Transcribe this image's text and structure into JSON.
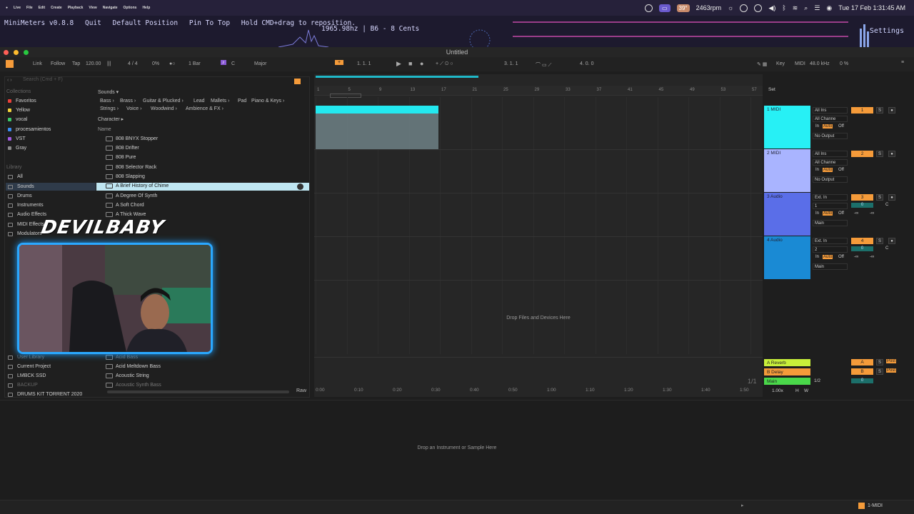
{
  "menubar": {
    "items": [
      "Live",
      "File",
      "Edit",
      "Create",
      "Playback",
      "View",
      "Navigate",
      "Options",
      "Help"
    ],
    "temp": "39°",
    "rpm": "2463rpm",
    "datetime": "Tue 17 Feb  1:31:45 AM"
  },
  "minimeters": {
    "title": "MiniMeters v0.8.8",
    "quit": "Quit",
    "default_position": "Default Position",
    "pin_to_top": "Pin To Top",
    "hint": "Hold CMD+drag to reposition.",
    "freq": "1965.98hz | B6 - 8 Cents",
    "settings": "Settings"
  },
  "window": {
    "title": "Untitled"
  },
  "control_bar": {
    "link": "Link",
    "follow": "Follow",
    "tap": "Tap",
    "tempo": "120.00",
    "signature": "4 / 4",
    "cpu": "0%",
    "quantize": "1 Bar",
    "key": "C",
    "scale": "Major",
    "position": "1.   1.   1",
    "loop_start": "3.   1.   1",
    "loop_len": "4.   0.   0",
    "key_btn": "Key",
    "midi_btn": "MIDI",
    "sample_rate": "48.0 kHz",
    "load": "0 %"
  },
  "browser": {
    "search_placeholder": "Search (Cmd + F)",
    "collections_label": "Collections",
    "collections": [
      {
        "label": "Favoritos",
        "color": "#e8413a"
      },
      {
        "label": "Yellow",
        "color": "#f0d23a"
      },
      {
        "label": "vocal",
        "color": "#3ac86a"
      },
      {
        "label": "procesamientos",
        "color": "#3a8cf0"
      },
      {
        "label": "VST",
        "color": "#a05ae0"
      },
      {
        "label": "Gray",
        "color": "#8a8a8a"
      }
    ],
    "library_label": "Library",
    "library": [
      "All",
      "Sounds",
      "Drums",
      "Instruments",
      "Audio Effects",
      "MIDI Effects",
      "Modulators"
    ],
    "places": [
      "User Library",
      "Current Project",
      "LMBCK SSD",
      "BACKUP",
      "DRUMS KIT TORRENT 2020"
    ],
    "sounds_filter": "Sounds ▾",
    "filter_row1": [
      "Bass ›",
      "Brass ›",
      "Guitar & Plucked ›",
      "Lead",
      "Mallets ›",
      "Pad",
      "Piano & Keys ›"
    ],
    "filter_row2": [
      "Strings ›",
      "Voice ›",
      "Woodwind ›",
      "Ambience & FX ›"
    ],
    "character": "Character ▸",
    "name_header": "Name",
    "files": [
      "808 BNYX Stopper",
      "808 Drifter",
      "808 Pure",
      "808 Selector Rack",
      "808 Slapping",
      "A Brief History of Chime",
      "A Degree Of Synth",
      "A Soft Chord",
      "A Thick Wave"
    ],
    "files_bottom": [
      "Acid Bass",
      "Acid Meltdown Bass",
      "Acoustic String",
      "Acoustic Synth Bass"
    ],
    "raw": "Raw"
  },
  "overlay": {
    "streamer_name": "DEVILBABY"
  },
  "arrangement": {
    "bar_ticks": [
      "1",
      "5",
      "9",
      "13",
      "17",
      "21",
      "25",
      "29",
      "33",
      "37",
      "41",
      "45",
      "49",
      "53",
      "57"
    ],
    "time_ticks": [
      "0:00",
      "0:10",
      "0:20",
      "0:30",
      "0:40",
      "0:50",
      "1:00",
      "1:10",
      "1:20",
      "1:30",
      "1:40",
      "1:50"
    ],
    "drop_files": "Drop Files and Devices Here",
    "page": "1/1",
    "set": "Set"
  },
  "tracks": [
    {
      "name": "1 MIDI",
      "color": "#27f0f5",
      "input": "All Ins",
      "channel": "All Channe",
      "output": "No Output",
      "num": "1"
    },
    {
      "name": "2 MIDI",
      "color": "#a9b4ff",
      "input": "All Ins",
      "channel": "All Channe",
      "output": "No Output",
      "num": "2"
    },
    {
      "name": "3 Audio",
      "color": "#5a6ee8",
      "input": "Ext. In",
      "channel": "1",
      "output": "Main",
      "num": "3"
    },
    {
      "name": "4 Audio",
      "color": "#1a8ad4",
      "input": "Ext. In",
      "channel": "2",
      "output": "Main",
      "num": "4"
    }
  ],
  "returns": [
    {
      "name": "A Reverb",
      "color": "#c8f03a",
      "letter": "A"
    },
    {
      "name": "B Delay",
      "color": "#f59b3a",
      "letter": "B"
    },
    {
      "name": "Main",
      "color": "#4ad84a",
      "letter": "1/2"
    }
  ],
  "io_labels": {
    "in": "In",
    "auto": "Auto",
    "off": "Off",
    "inf": "-∞",
    "c": "C",
    "zero": "0",
    "s": "S",
    "post": "Post",
    "h": "H",
    "w": "W",
    "tempo_scale": "1.00x"
  },
  "detail": {
    "drop_instrument": "Drop an Instrument or Sample Here"
  },
  "status": {
    "track": "1-MIDI"
  }
}
